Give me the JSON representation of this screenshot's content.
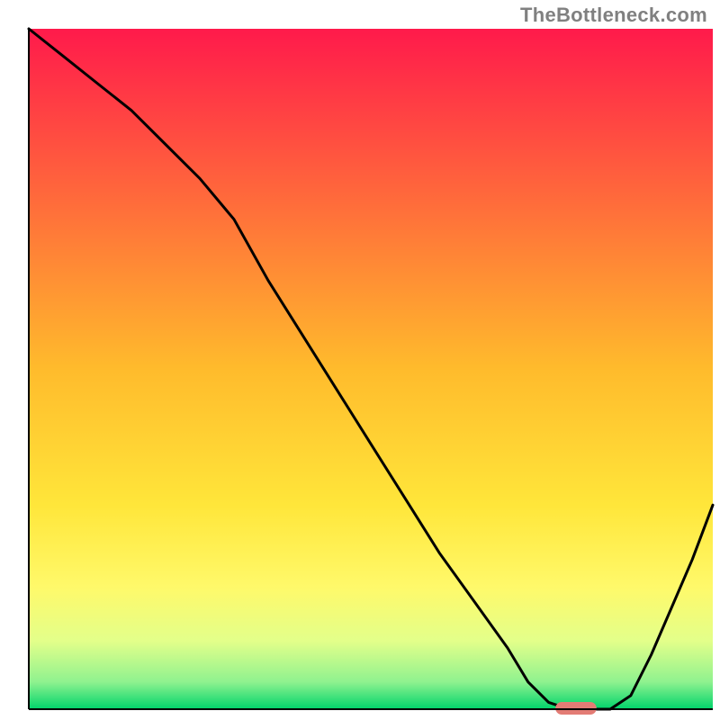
{
  "watermark": "TheBottleneck.com",
  "chart_data": {
    "type": "line",
    "title": "",
    "xlabel": "",
    "ylabel": "",
    "xlim": [
      0,
      100
    ],
    "ylim": [
      0,
      100
    ],
    "background_gradient": {
      "stops": [
        {
          "offset": 0.0,
          "color": "#ff1a4b"
        },
        {
          "offset": 0.25,
          "color": "#ff6a3b"
        },
        {
          "offset": 0.5,
          "color": "#ffbb2c"
        },
        {
          "offset": 0.7,
          "color": "#ffe63a"
        },
        {
          "offset": 0.82,
          "color": "#fff96a"
        },
        {
          "offset": 0.9,
          "color": "#e3ff8a"
        },
        {
          "offset": 0.96,
          "color": "#8ff28f"
        },
        {
          "offset": 1.0,
          "color": "#00d36b"
        }
      ]
    },
    "curve": {
      "x": [
        0,
        5,
        10,
        15,
        20,
        25,
        30,
        35,
        40,
        45,
        50,
        55,
        60,
        65,
        70,
        73,
        76,
        79,
        82,
        85,
        88,
        91,
        94,
        97,
        100
      ],
      "y": [
        100,
        96,
        92,
        88,
        83,
        78,
        72,
        63,
        55,
        47,
        39,
        31,
        23,
        16,
        9,
        4,
        1,
        0,
        0,
        0,
        2,
        8,
        15,
        22,
        30
      ]
    },
    "marker": {
      "x_start": 77,
      "x_end": 83,
      "y": 0,
      "color": "#e37c75"
    },
    "frame": {
      "left_border": true,
      "bottom_border": true,
      "top_border": false,
      "right_border": false,
      "stroke": "#000000",
      "stroke_width": 2
    }
  }
}
